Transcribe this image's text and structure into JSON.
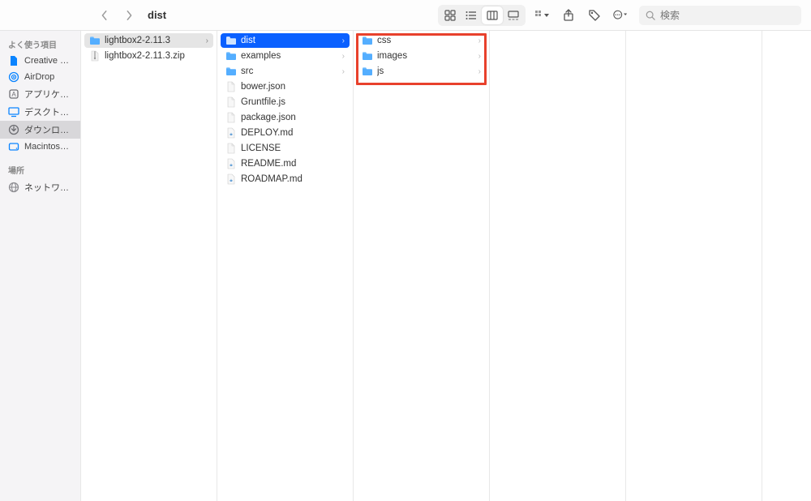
{
  "toolbar": {
    "title": "dist",
    "search_placeholder": "検索"
  },
  "sidebar": {
    "sections": [
      {
        "title": "よく使う項目",
        "items": [
          {
            "label": "Creative Clo...",
            "icon": "doc",
            "color": "#0a84ff"
          },
          {
            "label": "AirDrop",
            "icon": "airdrop",
            "color": "#0a84ff"
          },
          {
            "label": "アプリケーシ…",
            "icon": "app",
            "color": "#6e6e73"
          },
          {
            "label": "デスクトップ",
            "icon": "desktop",
            "color": "#0a84ff"
          },
          {
            "label": "ダウンロード",
            "icon": "download",
            "color": "#6e6e73",
            "selected": true
          },
          {
            "label": "Macintosh HD",
            "icon": "disk",
            "color": "#0a84ff"
          }
        ]
      },
      {
        "title": "場所",
        "items": [
          {
            "label": "ネットワーク",
            "icon": "network",
            "color": "#8e8e93"
          }
        ]
      }
    ]
  },
  "columns": [
    {
      "items": [
        {
          "name": "lightbox2-2.11.3",
          "type": "folder",
          "selected": "gray",
          "hasChildren": true
        },
        {
          "name": "lightbox2-2.11.3.zip",
          "type": "zip"
        }
      ]
    },
    {
      "items": [
        {
          "name": "dist",
          "type": "folder",
          "selected": "blue",
          "hasChildren": true
        },
        {
          "name": "examples",
          "type": "folder",
          "hasChildren": true
        },
        {
          "name": "src",
          "type": "folder",
          "hasChildren": true
        },
        {
          "name": "bower.json",
          "type": "file"
        },
        {
          "name": "Gruntfile.js",
          "type": "file"
        },
        {
          "name": "package.json",
          "type": "file"
        },
        {
          "name": "DEPLOY.md",
          "type": "md"
        },
        {
          "name": "LICENSE",
          "type": "file"
        },
        {
          "name": "README.md",
          "type": "md"
        },
        {
          "name": "ROADMAP.md",
          "type": "md"
        }
      ]
    },
    {
      "highlighted": true,
      "items": [
        {
          "name": "css",
          "type": "folder",
          "hasChildren": true
        },
        {
          "name": "images",
          "type": "folder",
          "hasChildren": true
        },
        {
          "name": "js",
          "type": "folder",
          "hasChildren": true
        }
      ]
    },
    {
      "items": []
    },
    {
      "items": []
    }
  ]
}
